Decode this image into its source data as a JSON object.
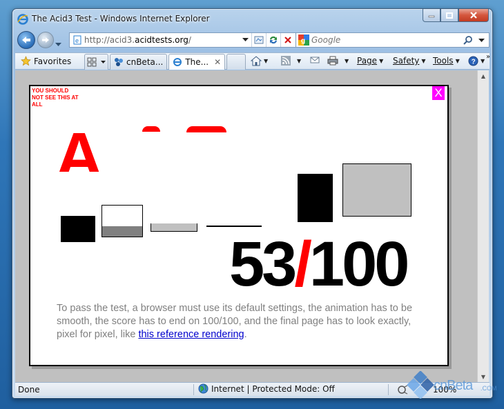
{
  "window": {
    "title": "The Acid3 Test - Windows Internet Explorer"
  },
  "nav": {
    "url_prefix": "http://acid3.",
    "url_domain": "acidtests.org",
    "url_suffix": "/",
    "search_placeholder": "Google"
  },
  "toolbar": {
    "favorites_label": "Favorites",
    "tabs": [
      {
        "label": "cnBeta..."
      },
      {
        "label": "The..."
      }
    ],
    "page_label": "Page",
    "safety_label": "Safety",
    "tools_label": "Tools"
  },
  "content": {
    "warning": "YOU SHOULD NOT SEE THIS AT ALL",
    "close_label": "X",
    "acid_title": "A",
    "score_num": "53",
    "score_slash": "/",
    "score_total": "100",
    "instructions": "To pass the test, a browser must use its default settings, the animation has to be smooth, the score has to end on 100/100, and the final page has to look exactly, pixel for pixel, like",
    "reference_link": "this reference rendering",
    "instructions_end": "."
  },
  "status": {
    "text": "Done",
    "zone": "Internet | Protected Mode: Off",
    "zoom": "100%"
  },
  "watermark": {
    "text": "cnBeta",
    "suffix": ".COM"
  },
  "colors": {
    "accent_red": "#ff0000",
    "magenta": "#ff00ff",
    "link": "#0000cc",
    "gray_text": "#808080"
  }
}
